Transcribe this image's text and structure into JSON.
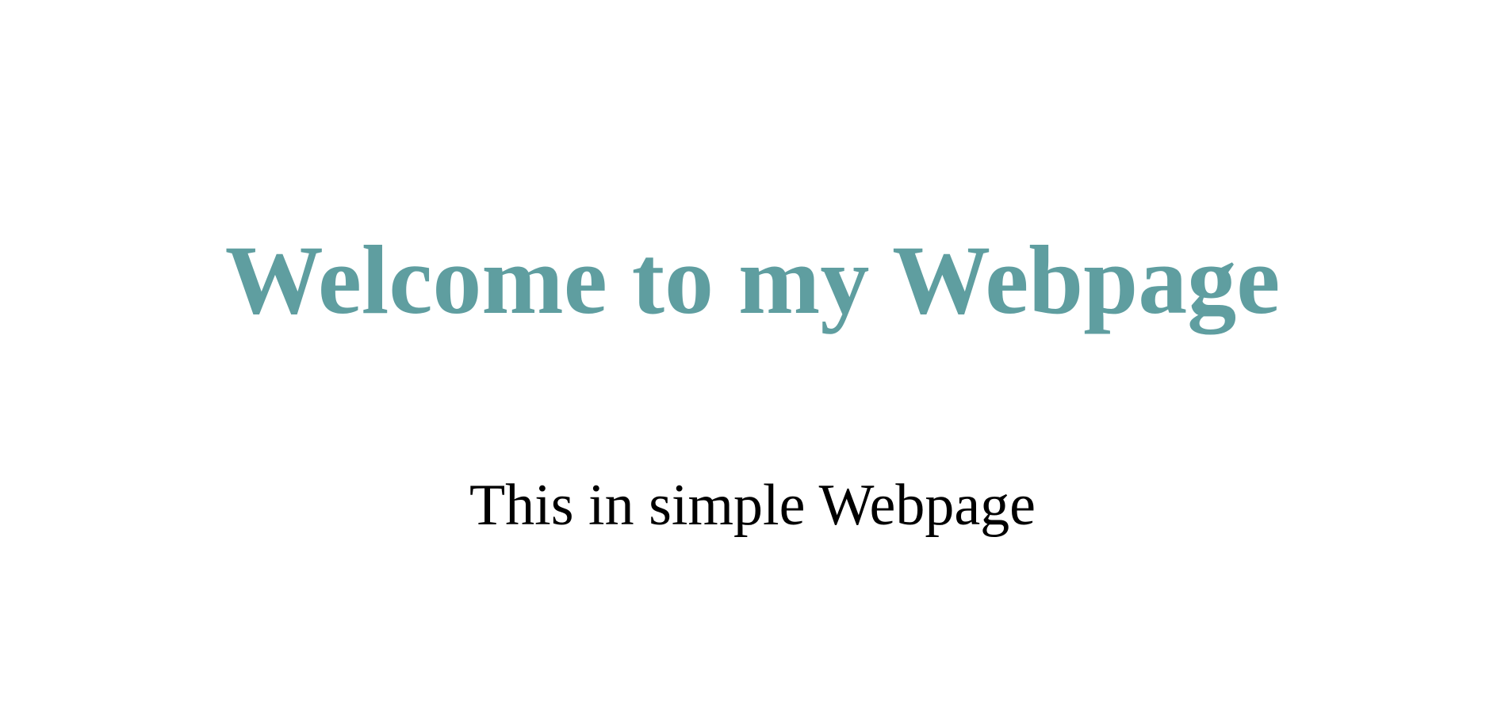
{
  "page": {
    "heading": "Welcome to my Webpage",
    "subtitle": "This in simple Webpage"
  },
  "colors": {
    "heading": "#5f9ea0",
    "subtitle": "#000000",
    "background": "#ffffff"
  }
}
